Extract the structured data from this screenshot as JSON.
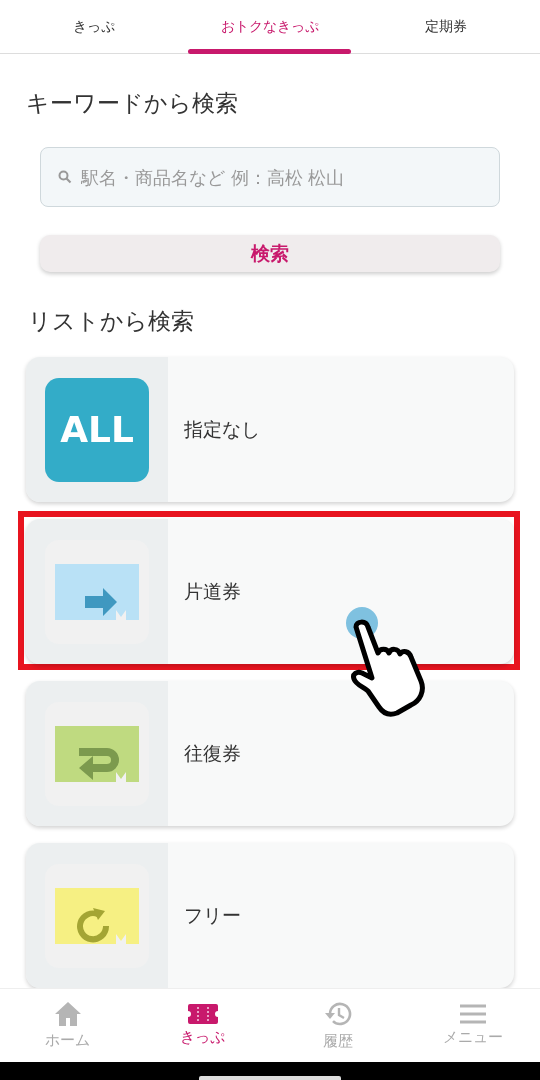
{
  "tabs": [
    {
      "label": "きっぷ",
      "selected": false
    },
    {
      "label": "おトクなきっぷ",
      "selected": true
    },
    {
      "label": "定期券",
      "selected": false
    }
  ],
  "keyword_search": {
    "heading": "キーワードから検索",
    "placeholder": "駅名・商品名など 例：高松 松山",
    "button": "検索"
  },
  "list_search": {
    "heading": "リストから検索",
    "items": [
      {
        "kind": "all",
        "badge": "ALL",
        "label": "指定なし",
        "highlighted": false
      },
      {
        "kind": "oneway",
        "label": "片道券",
        "highlighted": true
      },
      {
        "kind": "round",
        "label": "往復券",
        "highlighted": false
      },
      {
        "kind": "free",
        "label": "フリー",
        "highlighted": false
      }
    ]
  },
  "bottom_nav": [
    {
      "kind": "home",
      "label": "ホーム",
      "selected": false
    },
    {
      "kind": "ticket",
      "label": "きっぷ",
      "selected": true
    },
    {
      "kind": "history",
      "label": "履歴",
      "selected": false
    },
    {
      "kind": "menu",
      "label": "メニュー",
      "selected": false
    }
  ]
}
